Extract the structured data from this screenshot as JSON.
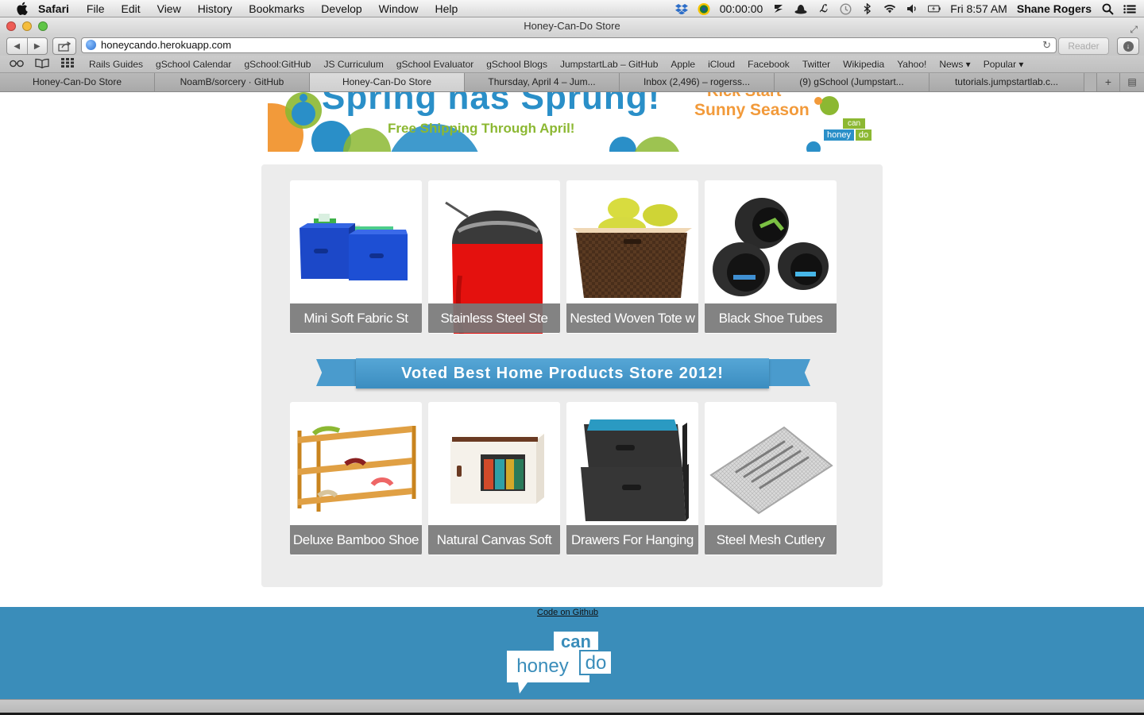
{
  "menubar": {
    "app": "Safari",
    "menus": [
      "File",
      "Edit",
      "View",
      "History",
      "Bookmarks",
      "Develop",
      "Window",
      "Help"
    ],
    "timer": "00:00:00",
    "clock": "Fri 8:57 AM",
    "user": "Shane Rogers"
  },
  "window": {
    "title": "Honey-Can-Do Store"
  },
  "toolbar": {
    "url": "honeycando.herokuapp.com",
    "reader_label": "Reader"
  },
  "bookmarks": [
    "Rails Guides",
    "gSchool Calendar",
    "gSchool:GitHub",
    "JS Curriculum",
    "gSchool Evaluator",
    "gSchool Blogs",
    "JumpstartLab – GitHub",
    "Apple",
    "iCloud",
    "Facebook",
    "Twitter",
    "Wikipedia",
    "Yahoo!",
    "News ▾",
    "Popular ▾"
  ],
  "tabs": [
    {
      "label": "Honey-Can-Do Store",
      "active": false
    },
    {
      "label": "NoamB/sorcery · GitHub",
      "active": false
    },
    {
      "label": "Honey-Can-Do Store",
      "active": true
    },
    {
      "label": "Thursday, April 4 – Jum...",
      "active": false
    },
    {
      "label": "Inbox (2,496) – rogerss...",
      "active": false
    },
    {
      "label": "(9) gSchool (Jumpstart...",
      "active": false
    },
    {
      "label": "tutorials.jumpstartlab.c...",
      "active": false
    }
  ],
  "banner": {
    "headline": "Spring has Sprung!",
    "subline": "Free Shipping Through April!",
    "kicker": "Kick Start",
    "season": "Sunny Season",
    "logo_top": "can",
    "logo_left": "honey",
    "logo_right": "do"
  },
  "products_row1": [
    {
      "name": "Mini Soft Fabric St"
    },
    {
      "name": "Stainless Steel Ste"
    },
    {
      "name": "Nested Woven Tote w"
    },
    {
      "name": "Black Shoe Tubes"
    }
  ],
  "ribbon": {
    "text": "Voted Best Home Products Store 2012!"
  },
  "products_row2": [
    {
      "name": "Deluxe Bamboo Shoe"
    },
    {
      "name": "Natural Canvas Soft"
    },
    {
      "name": "Drawers For Hanging"
    },
    {
      "name": "Steel Mesh Cutlery"
    }
  ],
  "footer": {
    "link": "Code on Github",
    "logo_top": "can",
    "logo_left": "honey",
    "logo_right": "do"
  },
  "colors": {
    "brand_blue": "#3a8dba",
    "ribbon_blue": "#4a9bcd",
    "accent_orange": "#f29a3a",
    "accent_green": "#8cb832"
  }
}
